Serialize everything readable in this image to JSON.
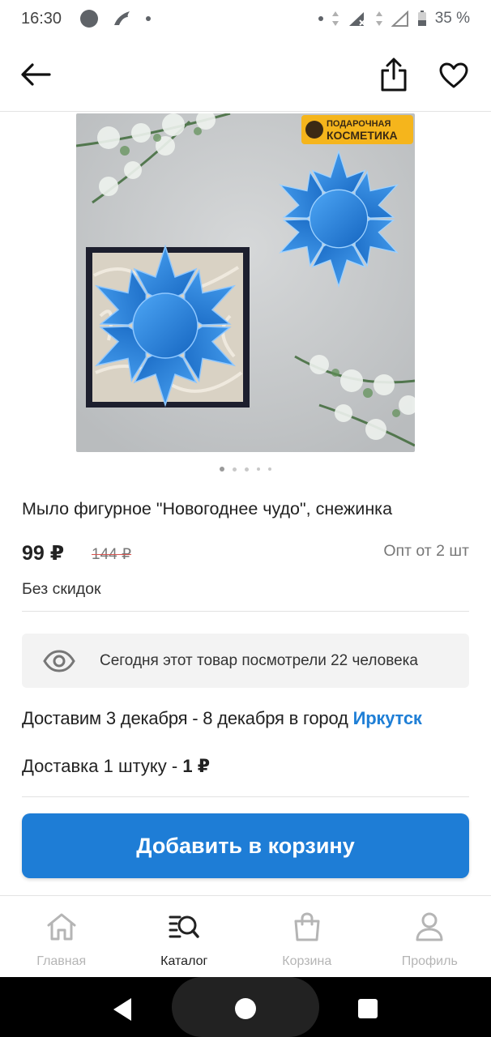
{
  "status_bar": {
    "time": "16:30",
    "battery": "35 %"
  },
  "app_bar": {
    "back_icon": "arrow-left-icon",
    "share_icon": "share-icon",
    "favorite_icon": "heart-icon"
  },
  "product": {
    "badge_line1": "ПОДАРОЧНАЯ",
    "badge_line2": "КОСМЕТИКА",
    "image_count": 5,
    "active_image": 1,
    "title": "Мыло фигурное \"Новогоднее чудо\", снежинка",
    "price": "99 ₽",
    "old_price": "144 ₽",
    "wholesale": "Опт от 2 шт",
    "discount_note": "Без скидок"
  },
  "views": {
    "icon": "eye-icon",
    "text": "Сегодня этот товар посмотрели 22 человека"
  },
  "delivery": {
    "dates_prefix": "Доставим 3 декабря - 8 декабря в город ",
    "city": "Иркутск",
    "cost_prefix": "Доставка 1 штуку  - ",
    "cost_value": "1 ₽"
  },
  "actions": {
    "add_to_cart": "Добавить в корзину"
  },
  "bottom_nav": {
    "items": [
      {
        "label": "Главная",
        "icon": "home-icon"
      },
      {
        "label": "Каталог",
        "icon": "catalog-search-icon"
      },
      {
        "label": "Корзина",
        "icon": "shopping-bag-icon"
      },
      {
        "label": "Профиль",
        "icon": "user-icon"
      }
    ],
    "active": "Каталог"
  },
  "colors": {
    "accent": "#1e7dd6",
    "link": "#1f7fd6",
    "badge_bg": "#f5b51c"
  }
}
